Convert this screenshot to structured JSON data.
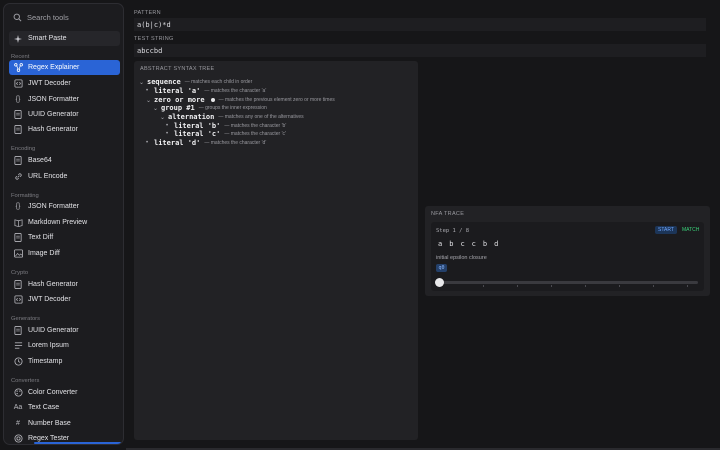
{
  "sidebar": {
    "search_placeholder": "Search tools",
    "smart_paste": "Smart Paste",
    "sections": {
      "recent": "Recent",
      "encoding": "Encoding",
      "formatting": "Formatting",
      "crypto": "Crypto",
      "generators": "Generators",
      "converters": "Converters"
    },
    "items": {
      "recent": [
        {
          "label": "Regex Explainer",
          "icon": "regex-icon"
        },
        {
          "label": "JWT Decoder",
          "icon": "code-icon"
        },
        {
          "label": "JSON Formatter",
          "icon": "braces-icon"
        },
        {
          "label": "UUID Generator",
          "icon": "document-icon"
        },
        {
          "label": "Hash Generator",
          "icon": "document-icon"
        }
      ],
      "encoding": [
        {
          "label": "Base64",
          "icon": "document-icon"
        },
        {
          "label": "URL Encode",
          "icon": "link-icon"
        }
      ],
      "formatting": [
        {
          "label": "JSON Formatter",
          "icon": "braces-icon"
        },
        {
          "label": "Markdown Preview",
          "icon": "book-icon"
        },
        {
          "label": "Text Diff",
          "icon": "document-icon"
        },
        {
          "label": "Image Diff",
          "icon": "image-icon"
        }
      ],
      "crypto": [
        {
          "label": "Hash Generator",
          "icon": "document-icon"
        },
        {
          "label": "JWT Decoder",
          "icon": "code-icon"
        }
      ],
      "generators": [
        {
          "label": "UUID Generator",
          "icon": "document-icon"
        },
        {
          "label": "Lorem Ipsum",
          "icon": "lines-icon"
        },
        {
          "label": "Timestamp",
          "icon": "clock-icon"
        }
      ],
      "converters": [
        {
          "label": "Color Converter",
          "icon": "palette-icon"
        },
        {
          "label": "Text Case",
          "icon": "text-case-icon",
          "glyph": "Aa"
        },
        {
          "label": "Number Base",
          "icon": "hash-icon",
          "glyph": "#"
        },
        {
          "label": "Regex Tester",
          "icon": "target-icon"
        }
      ]
    }
  },
  "main": {
    "pattern_label": "PATTERN",
    "pattern_value": "a(b|c)*d",
    "test_label": "TEST STRING",
    "test_value": "abccbd",
    "ast_title": "ABSTRACT SYNTAX TREE",
    "ast": [
      {
        "name": "sequence",
        "desc": "— matches each child in order",
        "toggle": "⌄"
      },
      {
        "name": "literal 'a'",
        "desc": "— matches the character 'a'",
        "toggle": "•"
      },
      {
        "name": "zero or more",
        "desc": "— matches the previous element zero or more times",
        "toggle": "⌄"
      },
      {
        "name": "group #1",
        "desc": "— groups the inner expression",
        "toggle": "⌄"
      },
      {
        "name": "alternation",
        "desc": "— matches any one of the alternatives",
        "toggle": "⌄"
      },
      {
        "name": "literal 'b'",
        "desc": "— matches the character 'b'",
        "toggle": "•"
      },
      {
        "name": "literal 'c'",
        "desc": "— matches the character 'c'",
        "toggle": "•"
      },
      {
        "name": "literal 'd'",
        "desc": "— matches the character 'd'",
        "toggle": "•"
      }
    ],
    "nfa": {
      "title": "NFA TRACE",
      "step": "Step 1 / 8",
      "badge_start": "START",
      "badge_match": "MATCH",
      "chars": [
        "a",
        "b",
        "c",
        "c",
        "b",
        "d"
      ],
      "epsilon": "initial epsilon closure",
      "state": "q0",
      "progress": 0
    }
  },
  "colors": {
    "accent": "#2a64d6",
    "match": "#3ad17a",
    "start": "#6ea6ff"
  }
}
